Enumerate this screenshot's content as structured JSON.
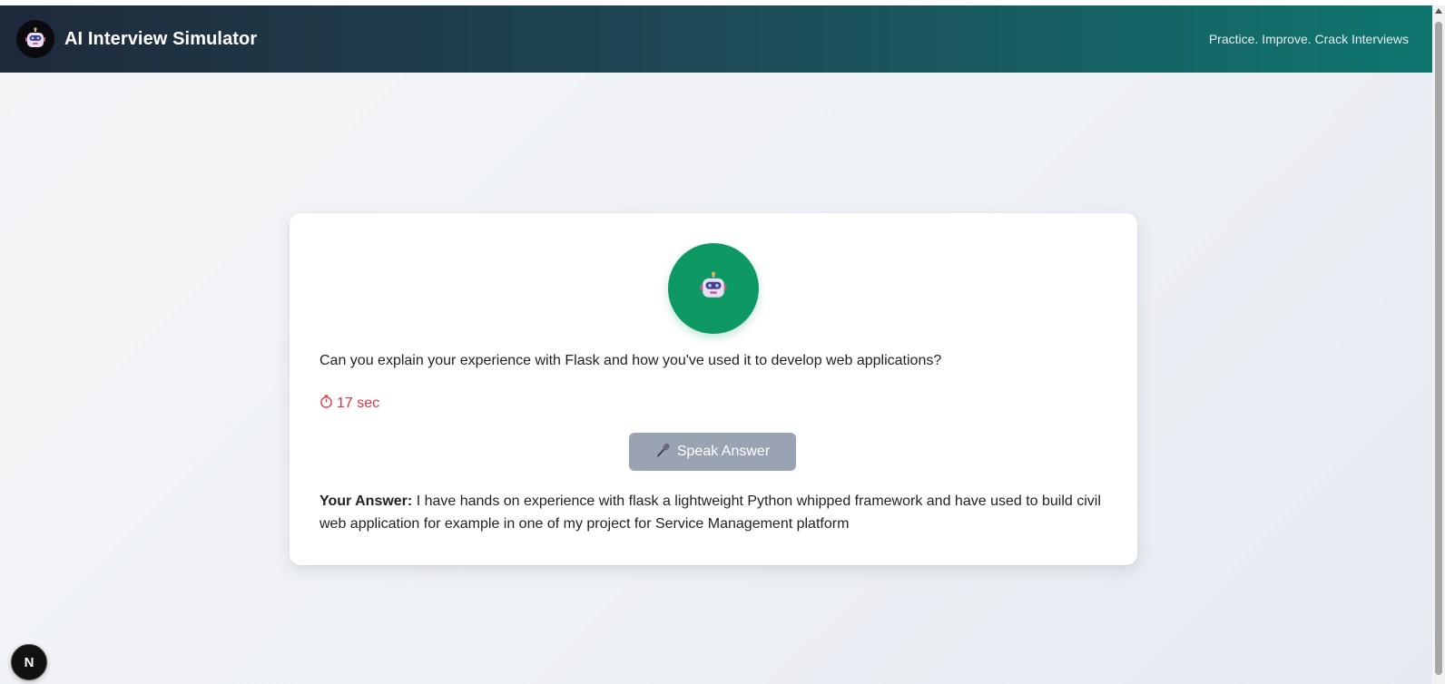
{
  "header": {
    "title": "AI Interview Simulator",
    "tagline": "Practice. Improve. Crack Interviews",
    "logo_icon": "robot-icon"
  },
  "interview": {
    "avatar_icon": "robot-icon",
    "avatar_color": "#0e9964",
    "question": "Can you explain your experience with Flask and how you've used it to develop web applications?",
    "timer_icon": "stopwatch-icon",
    "timer_text": "17 sec",
    "timer_color": "#e0323f",
    "speak_button_icon": "microphone-icon",
    "speak_button_label": "Speak Answer",
    "answer_label": "Your Answer:",
    "answer_text": "I have hands on experience with flask a lightweight Python whipped framework and have used to build civil web application for example in one of my project for Service Management platform"
  },
  "dev_badge": {
    "label": "N",
    "icon": "nextjs-icon"
  },
  "colors": {
    "header_start": "#1e293b",
    "header_end": "#0f766e",
    "button_bg": "#9aa3b2"
  }
}
